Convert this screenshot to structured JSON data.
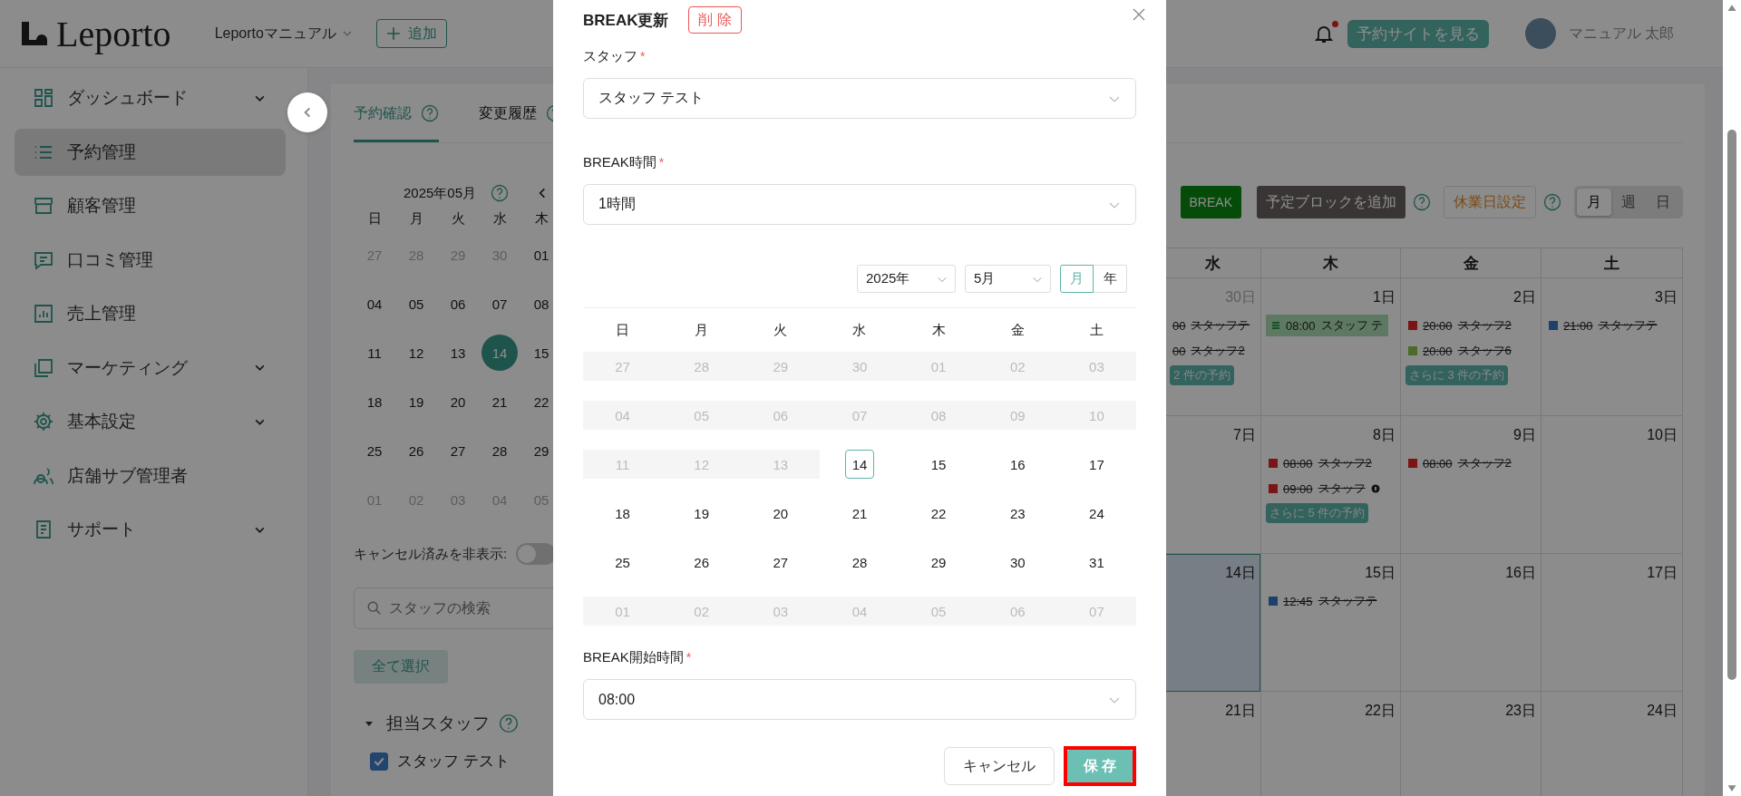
{
  "header": {
    "logo_text": "Leporto",
    "store": "Leportoマニュアル",
    "add_button": "追加",
    "has_notification": true,
    "view_site_button": "予約サイトを見る",
    "user_name": "マニュアル 太郎"
  },
  "sidebar": {
    "items": [
      {
        "label": "ダッシュボード",
        "expandable": true,
        "selected": false
      },
      {
        "label": "予約管理",
        "expandable": false,
        "selected": true
      },
      {
        "label": "顧客管理",
        "expandable": false,
        "selected": false
      },
      {
        "label": "口コミ管理",
        "expandable": false,
        "selected": false
      },
      {
        "label": "売上管理",
        "expandable": false,
        "selected": false
      },
      {
        "label": "マーケティング",
        "expandable": true,
        "selected": false
      },
      {
        "label": "基本設定",
        "expandable": true,
        "selected": false
      },
      {
        "label": "店舗サブ管理者",
        "expandable": false,
        "selected": false
      },
      {
        "label": "サポート",
        "expandable": true,
        "selected": false
      }
    ]
  },
  "tabs": [
    {
      "label": "予約確認",
      "selected": true
    },
    {
      "label": "変更履歴",
      "selected": false
    }
  ],
  "mini_calendar": {
    "title": "2025年05月",
    "weekdays": [
      "日",
      "月",
      "火",
      "水",
      "木"
    ],
    "weeks": [
      [
        {
          "day": "27",
          "muted": true,
          "selected": false
        },
        {
          "day": "28",
          "muted": true,
          "selected": false
        },
        {
          "day": "29",
          "muted": true,
          "selected": false
        },
        {
          "day": "30",
          "muted": true,
          "selected": false
        },
        {
          "day": "01",
          "muted": false,
          "selected": false
        }
      ],
      [
        {
          "day": "04",
          "muted": false,
          "selected": false
        },
        {
          "day": "05",
          "muted": false,
          "selected": false
        },
        {
          "day": "06",
          "muted": false,
          "selected": false
        },
        {
          "day": "07",
          "muted": false,
          "selected": false
        },
        {
          "day": "08",
          "muted": false,
          "selected": false
        }
      ],
      [
        {
          "day": "11",
          "muted": false,
          "selected": false
        },
        {
          "day": "12",
          "muted": false,
          "selected": false
        },
        {
          "day": "13",
          "muted": false,
          "selected": false
        },
        {
          "day": "14",
          "muted": false,
          "selected": true
        },
        {
          "day": "15",
          "muted": false,
          "selected": false
        }
      ],
      [
        {
          "day": "18",
          "muted": false,
          "selected": false
        },
        {
          "day": "19",
          "muted": false,
          "selected": false
        },
        {
          "day": "20",
          "muted": false,
          "selected": false
        },
        {
          "day": "21",
          "muted": false,
          "selected": false
        },
        {
          "day": "22",
          "muted": false,
          "selected": false
        }
      ],
      [
        {
          "day": "25",
          "muted": false,
          "selected": false
        },
        {
          "day": "26",
          "muted": false,
          "selected": false
        },
        {
          "day": "27",
          "muted": false,
          "selected": false
        },
        {
          "day": "28",
          "muted": false,
          "selected": false
        },
        {
          "day": "29",
          "muted": false,
          "selected": false
        }
      ],
      [
        {
          "day": "01",
          "muted": true,
          "selected": false
        },
        {
          "day": "02",
          "muted": true,
          "selected": false
        },
        {
          "day": "03",
          "muted": true,
          "selected": false
        },
        {
          "day": "04",
          "muted": true,
          "selected": false
        },
        {
          "day": "05",
          "muted": true,
          "selected": false
        }
      ]
    ]
  },
  "cancel_filter": {
    "label": "キャンセル済みを非表示:",
    "on": false
  },
  "staff_search": {
    "placeholder": "スタッフの検索"
  },
  "select_all_button": "全て選択",
  "staff_group": {
    "title": "担当スタッフ",
    "expanded": true,
    "staff": [
      {
        "name": "スタッフ テスト",
        "checked": true
      }
    ]
  },
  "toolbar": {
    "break_button": "BREAK",
    "add_block_button": "予定ブロックを追加",
    "holiday_button": "休業日設定",
    "views": [
      {
        "label": "月",
        "selected": true
      },
      {
        "label": "週",
        "selected": false
      },
      {
        "label": "日",
        "selected": false
      }
    ]
  },
  "calendar": {
    "weekdays": [
      "水",
      "木",
      "金",
      "土"
    ],
    "weeks": [
      [
        {
          "date": "30日",
          "muted": true,
          "today": false,
          "events": [
            {
              "kind": "booking",
              "time": "00",
              "staff": "スタッフテ",
              "cancelled": true
            },
            {
              "kind": "booking",
              "time": "00",
              "staff": "スタッフ2",
              "cancelled": true
            }
          ],
          "more": "2 件の予約"
        },
        {
          "date": "1日",
          "muted": false,
          "today": false,
          "events": [
            {
              "kind": "break",
              "time": "08:00",
              "staff": "スタッフ テ",
              "cancelled": false
            }
          ]
        },
        {
          "date": "2日",
          "muted": false,
          "today": false,
          "events": [
            {
              "kind": "booking",
              "time": "20:00",
              "staff": "スタッフ2",
              "color": "#7b1414",
              "cancelled": true
            },
            {
              "kind": "booking",
              "time": "20:00",
              "staff": "スタッフ6",
              "color": "#4c6b29",
              "cancelled": true
            }
          ],
          "more": "さらに 3 件の予約"
        },
        {
          "date": "3日",
          "muted": false,
          "today": false,
          "events": [
            {
              "kind": "booking",
              "time": "21:00",
              "staff": "スタッフテ",
              "color": "#20406c",
              "cancelled": true
            }
          ]
        }
      ],
      [
        {
          "date": "7日",
          "muted": false,
          "today": false
        },
        {
          "date": "8日",
          "muted": false,
          "today": false,
          "events": [
            {
              "kind": "booking",
              "time": "08:00",
              "staff": "スタッフ2",
              "color": "#7b1414",
              "cancelled": true
            },
            {
              "kind": "booking",
              "time": "09:00",
              "staff": "スタッフ",
              "color": "#7b1414",
              "cancelled": true,
              "marked": true
            }
          ],
          "more": "さらに 5 件の予約"
        },
        {
          "date": "9日",
          "muted": false,
          "today": false,
          "events": [
            {
              "kind": "booking",
              "time": "08:00",
              "staff": "スタッフ2",
              "color": "#7b1414",
              "cancelled": true
            }
          ]
        },
        {
          "date": "10日",
          "muted": false,
          "today": false
        }
      ],
      [
        {
          "date": "14日",
          "muted": false,
          "today": true
        },
        {
          "date": "15日",
          "muted": false,
          "today": false,
          "events": [
            {
              "kind": "booking",
              "time": "12:45",
              "staff": "スタッフテ",
              "color": "#20406c",
              "cancelled": true
            }
          ]
        },
        {
          "date": "16日",
          "muted": false,
          "today": false
        },
        {
          "date": "17日",
          "muted": false,
          "today": false
        }
      ],
      [
        {
          "date": "21日",
          "muted": false,
          "today": false
        },
        {
          "date": "22日",
          "muted": false,
          "today": false
        },
        {
          "date": "23日",
          "muted": false,
          "today": false
        },
        {
          "date": "24日",
          "muted": false,
          "today": false
        }
      ]
    ]
  },
  "dialog": {
    "title": "BREAK更新",
    "delete_button": "削 除",
    "fields": [
      {
        "label": "スタッフ",
        "required_mark": "*",
        "value": "スタッフ テスト"
      },
      {
        "label": "BREAK時間",
        "required_mark": "*",
        "value": "1時間"
      }
    ],
    "date_picker": {
      "year": "2025年",
      "month": "5月",
      "modes": [
        {
          "label": "月",
          "selected": true
        },
        {
          "label": "年",
          "selected": false
        }
      ],
      "weekdays": [
        "日",
        "月",
        "火",
        "水",
        "木",
        "金",
        "土"
      ],
      "weeks": [
        [
          {
            "day": "27",
            "disabled": true,
            "selected": false
          },
          {
            "day": "28",
            "disabled": true,
            "selected": false
          },
          {
            "day": "29",
            "disabled": true,
            "selected": false
          },
          {
            "day": "30",
            "disabled": true,
            "selected": false
          },
          {
            "day": "01",
            "disabled": true,
            "selected": false
          },
          {
            "day": "02",
            "disabled": true,
            "selected": false
          },
          {
            "day": "03",
            "disabled": true,
            "selected": false
          }
        ],
        [
          {
            "day": "04",
            "disabled": true,
            "selected": false
          },
          {
            "day": "05",
            "disabled": true,
            "selected": false
          },
          {
            "day": "06",
            "disabled": true,
            "selected": false
          },
          {
            "day": "07",
            "disabled": true,
            "selected": false
          },
          {
            "day": "08",
            "disabled": true,
            "selected": false
          },
          {
            "day": "09",
            "disabled": true,
            "selected": false
          },
          {
            "day": "10",
            "disabled": true,
            "selected": false
          }
        ],
        [
          {
            "day": "11",
            "disabled": true,
            "selected": false
          },
          {
            "day": "12",
            "disabled": true,
            "selected": false
          },
          {
            "day": "13",
            "disabled": true,
            "selected": false
          },
          {
            "day": "14",
            "disabled": false,
            "selected": true
          },
          {
            "day": "15",
            "disabled": false,
            "selected": false
          },
          {
            "day": "16",
            "disabled": false,
            "selected": false
          },
          {
            "day": "17",
            "disabled": false,
            "selected": false
          }
        ],
        [
          {
            "day": "18",
            "disabled": false,
            "selected": false
          },
          {
            "day": "19",
            "disabled": false,
            "selected": false
          },
          {
            "day": "20",
            "disabled": false,
            "selected": false
          },
          {
            "day": "21",
            "disabled": false,
            "selected": false
          },
          {
            "day": "22",
            "disabled": false,
            "selected": false
          },
          {
            "day": "23",
            "disabled": false,
            "selected": false
          },
          {
            "day": "24",
            "disabled": false,
            "selected": false
          }
        ],
        [
          {
            "day": "25",
            "disabled": false,
            "selected": false
          },
          {
            "day": "26",
            "disabled": false,
            "selected": false
          },
          {
            "day": "27",
            "disabled": false,
            "selected": false
          },
          {
            "day": "28",
            "disabled": false,
            "selected": false
          },
          {
            "day": "29",
            "disabled": false,
            "selected": false
          },
          {
            "day": "30",
            "disabled": false,
            "selected": false
          },
          {
            "day": "31",
            "disabled": false,
            "selected": false
          }
        ],
        [
          {
            "day": "01",
            "disabled": true,
            "selected": false
          },
          {
            "day": "02",
            "disabled": true,
            "selected": false
          },
          {
            "day": "03",
            "disabled": true,
            "selected": false
          },
          {
            "day": "04",
            "disabled": true,
            "selected": false
          },
          {
            "day": "05",
            "disabled": true,
            "selected": false
          },
          {
            "day": "06",
            "disabled": true,
            "selected": false
          },
          {
            "day": "07",
            "disabled": true,
            "selected": false
          }
        ]
      ]
    },
    "start_field": {
      "label": "BREAK開始時間",
      "required_mark": "*",
      "value": "08:00"
    },
    "cancel_button": "キャンセル",
    "save_button": {
      "label": "保 存",
      "highlighted": true
    }
  }
}
